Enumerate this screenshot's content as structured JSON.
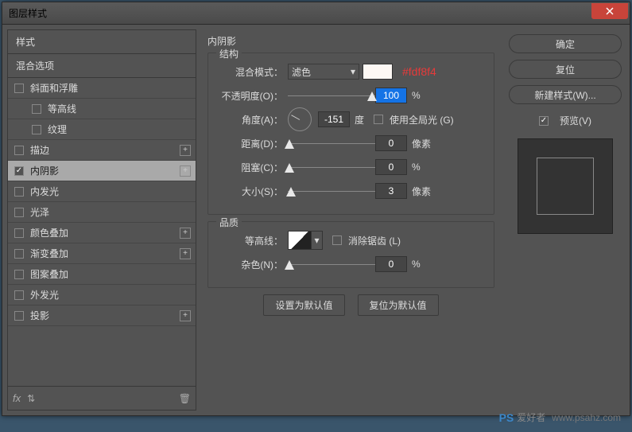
{
  "window": {
    "title": "图层样式"
  },
  "sidebar": {
    "styles_header": "样式",
    "blend_header": "混合选项",
    "items": [
      {
        "label": "斜面和浮雕",
        "checked": false,
        "plus": false,
        "indent": false
      },
      {
        "label": "等高线",
        "checked": false,
        "plus": false,
        "indent": true
      },
      {
        "label": "纹理",
        "checked": false,
        "plus": false,
        "indent": true
      },
      {
        "label": "描边",
        "checked": false,
        "plus": true,
        "indent": false
      },
      {
        "label": "内阴影",
        "checked": true,
        "plus": true,
        "indent": false,
        "selected": true
      },
      {
        "label": "内发光",
        "checked": false,
        "plus": false,
        "indent": false
      },
      {
        "label": "光泽",
        "checked": false,
        "plus": false,
        "indent": false
      },
      {
        "label": "颜色叠加",
        "checked": false,
        "plus": true,
        "indent": false
      },
      {
        "label": "渐变叠加",
        "checked": false,
        "plus": true,
        "indent": false
      },
      {
        "label": "图案叠加",
        "checked": false,
        "plus": false,
        "indent": false
      },
      {
        "label": "外发光",
        "checked": false,
        "plus": false,
        "indent": false
      },
      {
        "label": "投影",
        "checked": false,
        "plus": true,
        "indent": false
      }
    ],
    "footer_fx": "fx"
  },
  "center": {
    "title": "内阴影",
    "structure": {
      "legend": "结构",
      "blend_mode_label": "混合模式：",
      "blend_mode_value": "滤色",
      "color_hex": "#fdf8f4",
      "opacity_label": "不透明度(O)：",
      "opacity_value": "100",
      "opacity_unit": "%",
      "angle_label": "角度(A)：",
      "angle_value": "-151",
      "angle_unit": "度",
      "global_light_label": "使用全局光 (G)",
      "distance_label": "距离(D)：",
      "distance_value": "0",
      "distance_unit": "像素",
      "choke_label": "阻塞(C)：",
      "choke_value": "0",
      "choke_unit": "%",
      "size_label": "大小(S)：",
      "size_value": "3",
      "size_unit": "像素"
    },
    "quality": {
      "legend": "品质",
      "contour_label": "等高线：",
      "antialias_label": "消除锯齿 (L)",
      "noise_label": "杂色(N)：",
      "noise_value": "0",
      "noise_unit": "%"
    },
    "reset_default": "设置为默认值",
    "restore_default": "复位为默认值"
  },
  "right": {
    "ok": "确定",
    "cancel": "复位",
    "new_style": "新建样式(W)...",
    "preview": "预览(V)"
  },
  "watermark": {
    "brand": "PS",
    "text": "爱好者",
    "url": "www.psahz.com"
  }
}
